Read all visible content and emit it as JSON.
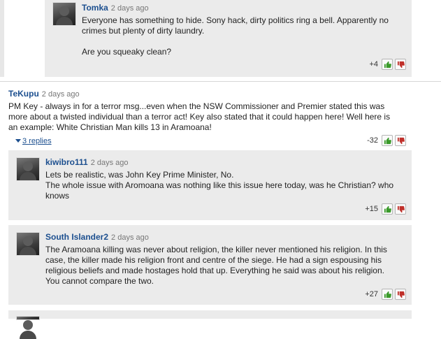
{
  "comments": [
    {
      "author": "Tomka",
      "time": "2 days ago",
      "lines": [
        "Everyone has something to hide. Sony hack, dirty politics ring a bell. Apparently no",
        "crimes but plenty of dirty laundry.",
        "",
        "Are you squeaky clean?"
      ],
      "score": "+4"
    },
    {
      "author": "TeKupu",
      "time": "2 days ago",
      "lines": [
        "PM Key - always in for a terror msg...even when the NSW Commissioner and Premier stated this was",
        "more about a twisted individual than a terror act! Key also stated that it could happen here! Well here is",
        "an example: White Christian Man kills 13 in Aramoana!"
      ],
      "replies_link": "3 replies",
      "score": "-32"
    },
    {
      "author": "kiwibro111",
      "time": "2 days ago",
      "lines": [
        "Lets be realistic, was John Key Prime Minister, No.",
        "The whole issue with Aromoana was nothing like this issue here today, was he Christian? who",
        "knows"
      ],
      "score": "+15"
    },
    {
      "author": "South Islander2",
      "time": "2 days ago",
      "lines": [
        "The Aramoana killing was never about religion, the killer never mentioned his religion. In this",
        "case, the killer made his religion front and centre of the siege. He had a sign espousing his",
        "religious beliefs and made hostages hold that up. Everything he said was about his religion.",
        "You cannot compare the two."
      ],
      "score": "+27"
    }
  ],
  "icons": {
    "upvote": "thumbs-up-icon",
    "downvote": "thumbs-down-icon"
  },
  "colors": {
    "author": "#1c4f8f",
    "reply_bg": "#ebebeb",
    "upvote": "#3a9a2a",
    "downvote": "#c0302a"
  }
}
